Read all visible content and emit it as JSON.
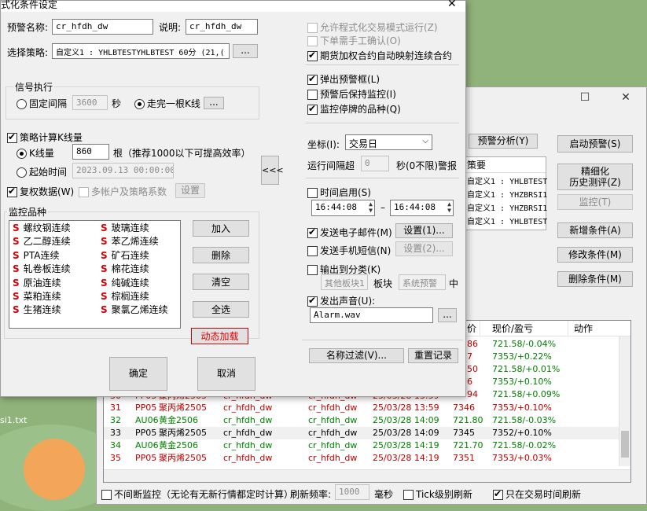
{
  "desktop": {
    "file_label": "si1.txt"
  },
  "main_window": {
    "buttons": {
      "warning_analysis": "预警分析(Y)",
      "start_warning": "启动预警(S)",
      "refined_history_line1": "精细化",
      "refined_history_line2": "历史测评(Z)",
      "monitor": "监控(T)",
      "add_condition": "新增条件(A)",
      "modify_condition": "修改条件(M)",
      "delete_condition": "删除条件(M)"
    },
    "strategy_list_header": "策要",
    "strategy_list": [
      "自定义1 : YHLBTEST",
      "自定义1 : YHZBRSI1",
      "自定义1 : YHZBRSI1",
      "自定义1 : YHLBTEST"
    ],
    "table": {
      "headers": {
        "price": "价",
        "pnl": "现价/盈亏",
        "action": "动作"
      },
      "partial_rows": [
        {
          "price": "86",
          "pnl": "721.58/-0.04%"
        },
        {
          "price": "7",
          "pnl": "7353/+0.22%"
        },
        {
          "price": "50",
          "pnl": "721.58/+0.01%"
        },
        {
          "price": "6",
          "pnl": "7353/+0.10%"
        },
        {
          "price": "94",
          "pnl": "721.58/+0.09%"
        }
      ],
      "partial_row_30": {
        "no": "30",
        "code": "PP05",
        "name": "聚丙烯2505",
        "a": "cr_hfdh_dw",
        "b": "cr_hfdh_dw",
        "time": "25/03/28 13:59"
      },
      "rows": [
        {
          "no": "31",
          "code": "PP05",
          "name": "聚丙烯2505",
          "a": "cr_hfdh_dw",
          "b": "cr_hfdh_dw",
          "time": "25/03/28 13:59",
          "price": "7346",
          "pnl": "7353/+0.10%",
          "color": "#c00000"
        },
        {
          "no": "32",
          "code": "AU06",
          "name": "黄金2506",
          "a": "cr_hfdh_dw",
          "b": "cr_hfdh_dw",
          "time": "25/03/28 14:09",
          "price": "721.80",
          "pnl": "721.58/-0.03%",
          "color": "#008000"
        },
        {
          "no": "33",
          "code": "PP05",
          "name": "聚丙烯2505",
          "a": "cr_hfdh_dw",
          "b": "cr_hfdh_dw",
          "time": "25/03/28 14:09",
          "price": "7345",
          "pnl": "7352/+0.10%",
          "color": "#000000"
        },
        {
          "no": "34",
          "code": "AU06",
          "name": "黄金2506",
          "a": "cr_hfdh_dw",
          "b": "cr_hfdh_dw",
          "time": "25/03/28 14:19",
          "price": "721.70",
          "pnl": "721.58/-0.02%",
          "color": "#008000"
        },
        {
          "no": "35",
          "code": "PP05",
          "name": "聚丙烯2505",
          "a": "cr_hfdh_dw",
          "b": "cr_hfdh_dw",
          "time": "25/03/28 14:19",
          "price": "7351",
          "pnl": "7353/+0.03%",
          "color": "#c00000"
        }
      ]
    },
    "footer": {
      "continuous_monitor": "不间断监控（无论有无新行情都定时计算）",
      "refresh_rate": "刷新频率:",
      "refresh_value": "1000",
      "ms": "毫秒",
      "tick_refresh": "Tick级别刷新",
      "only_trading": "只在交易时间刷新"
    }
  },
  "dialog": {
    "title": "式化条件设定",
    "warning_name_label": "预警名称:",
    "warning_name": "cr_hfdh_dw",
    "desc_label": "说明:",
    "desc": "cr_hfdh_dw",
    "strategy_label": "选择策略:",
    "strategy": "自定义1 : YHLBTESTYHLBTEST 60分 (21,(",
    "ellipsis": "...",
    "signal_group": "信号执行",
    "fixed_interval": "固定间隔",
    "interval_value": "3600",
    "seconds": "秒",
    "complete_kline": "走完一根K线",
    "calc_kline": "策略计算K线量",
    "kline_count_label": "K线量",
    "kline_count": "860",
    "kline_hint": "根（推荐1000以下可提高效率）",
    "start_time_label": "起始时间",
    "start_time": "2023.09.13 00:00:00",
    "collapse": "<<<",
    "fq_data": "复权数据(W)",
    "multi_account": "多帐户及策略系数",
    "settings": "设置",
    "monitor_group": "监控品种",
    "s_glyph": "S",
    "varieties_left": [
      "螺纹钢连续",
      "乙二醇连续",
      "PTA连续",
      "轧卷板连续",
      "原油连续",
      "菜粕连续",
      "生猪连续"
    ],
    "varieties_right": [
      "玻璃连续",
      "苯乙烯连续",
      "矿石连续",
      "棉花连续",
      "纯碱连续",
      "棕榈连续",
      "聚氯乙烯连续"
    ],
    "add": "加入",
    "delete": "删除",
    "clear": "清空",
    "select_all": "全选",
    "dynamic_load": "动态加载",
    "ok": "确定",
    "cancel": "取消",
    "allow_programmatic": "允许程式化交易模式运行(Z)",
    "manual_confirm": "下单需手工确认(O)",
    "auto_map": "期货加权合约自动映射连续合约",
    "popup_warning": "弹出预警框(L)",
    "keep_monitor": "预警后保持监控(I)",
    "monitor_stopped": "监控停牌的品种(Q)",
    "coord_label": "坐标(I):",
    "coord_value": "交易日",
    "run_interval_label": "运行间隔超",
    "run_interval_value": "0",
    "run_interval_suffix": "秒(0不限)警报",
    "time_enable": "时间启用(S)",
    "time_from": "16:44:08",
    "time_dash": "–",
    "time_to": "16:44:08",
    "send_email": "发送电子邮件(M)",
    "settings_1": "设置(1)...",
    "send_sms": "发送手机短信(N)",
    "settings_2": "设置(2)...",
    "output_category": "输出到分类(K)",
    "other_block": "其他板块1",
    "block": "板块",
    "system_warning": "系统预警",
    "mid": "中",
    "play_sound": "发出声音(U):",
    "sound_file": "Alarm.wav",
    "name_filter": "名称过滤(V)...",
    "reset_record": "重置记录"
  }
}
